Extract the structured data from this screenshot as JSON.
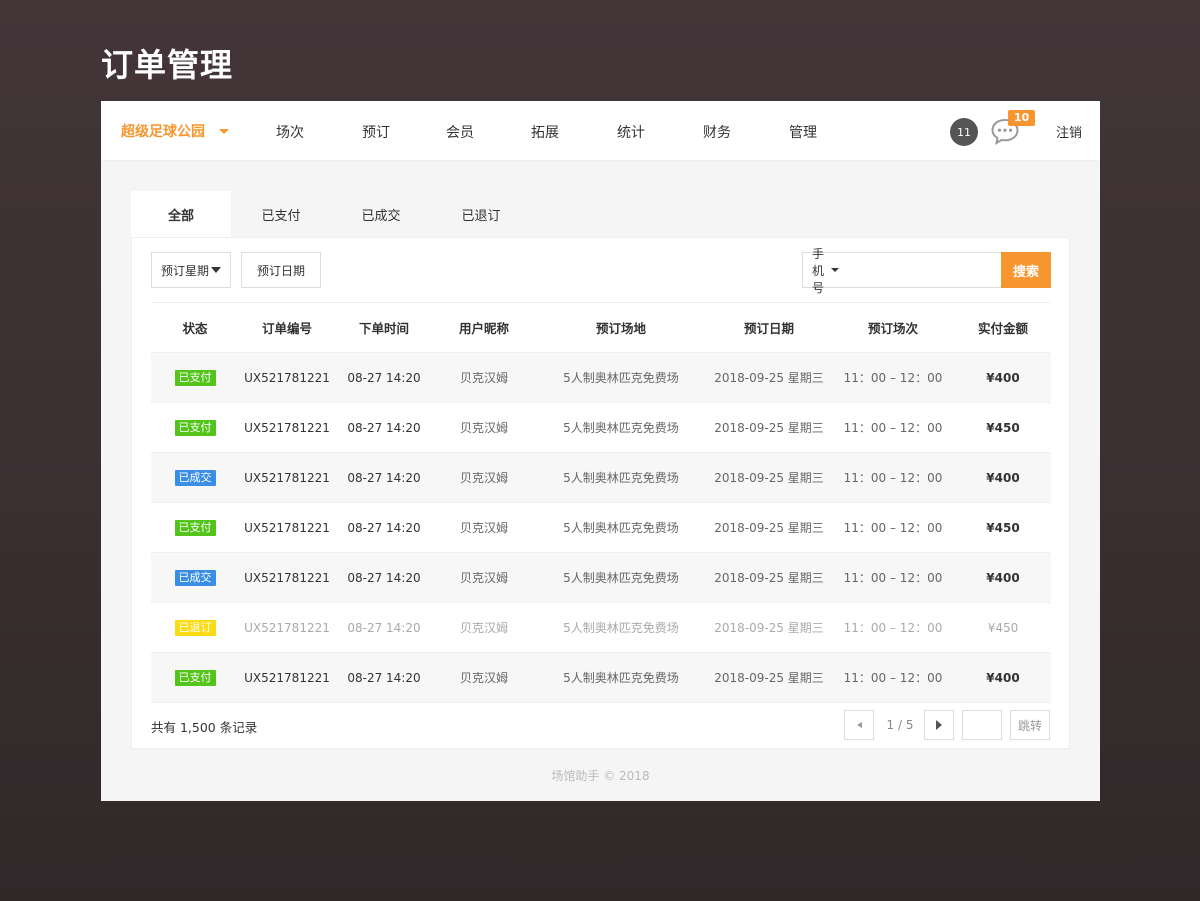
{
  "page_title": "订单管理",
  "nav": {
    "venue": "超级足球公园",
    "items": [
      "场次",
      "预订",
      "会员",
      "拓展",
      "统计",
      "财务",
      "管理"
    ],
    "count_badge": "11",
    "message_badge": "10",
    "logout": "注销"
  },
  "tabs": [
    "全部",
    "已支付",
    "已成交",
    "已退订"
  ],
  "active_tab": "全部",
  "filters": {
    "weekday": "预订星期",
    "date": "预订日期",
    "search_type": "手机号",
    "search_value": "",
    "search_button": "搜索"
  },
  "table": {
    "headers": [
      "状态",
      "订单编号",
      "下单时间",
      "用户昵称",
      "预订场地",
      "预订日期",
      "预订场次",
      "实付金额"
    ],
    "rows": [
      {
        "status": "已支付",
        "order_no": "UX521781221",
        "time": "08-27 14:20",
        "nickname": "贝克汉姆",
        "venue": "5人制奥林匹克免费场",
        "date": "2018-09-25 星期三",
        "slot": "11：00 – 12：00",
        "amount": "¥400"
      },
      {
        "status": "已支付",
        "order_no": "UX521781221",
        "time": "08-27 14:20",
        "nickname": "贝克汉姆",
        "venue": "5人制奥林匹克免费场",
        "date": "2018-09-25 星期三",
        "slot": "11：00 – 12：00",
        "amount": "¥450"
      },
      {
        "status": "已成交",
        "order_no": "UX521781221",
        "time": "08-27 14:20",
        "nickname": "贝克汉姆",
        "venue": "5人制奥林匹克免费场",
        "date": "2018-09-25 星期三",
        "slot": "11：00 – 12：00",
        "amount": "¥400"
      },
      {
        "status": "已支付",
        "order_no": "UX521781221",
        "time": "08-27 14:20",
        "nickname": "贝克汉姆",
        "venue": "5人制奥林匹克免费场",
        "date": "2018-09-25 星期三",
        "slot": "11：00 – 12：00",
        "amount": "¥450"
      },
      {
        "status": "已成交",
        "order_no": "UX521781221",
        "time": "08-27 14:20",
        "nickname": "贝克汉姆",
        "venue": "5人制奥林匹克免费场",
        "date": "2018-09-25 星期三",
        "slot": "11：00 – 12：00",
        "amount": "¥400"
      },
      {
        "status": "已退订",
        "order_no": "UX521781221",
        "time": "08-27 14:20",
        "nickname": "贝克汉姆",
        "venue": "5人制奥林匹克免费场",
        "date": "2018-09-25 星期三",
        "slot": "11：00 – 12：00",
        "amount": "¥450"
      },
      {
        "status": "已支付",
        "order_no": "UX521781221",
        "time": "08-27 14:20",
        "nickname": "贝克汉姆",
        "venue": "5人制奥林匹克免费场",
        "date": "2018-09-25 星期三",
        "slot": "11：00 – 12：00",
        "amount": "¥400"
      }
    ]
  },
  "status_colors": {
    "已支付": "#52c41a",
    "已成交": "#3a8ee6",
    "已退订": "#fadb14"
  },
  "pagination": {
    "total": "共有 1,500 条记录",
    "page_info": "1 / 5",
    "jump_label": "跳转"
  },
  "footer": "场馆助手 © 2018"
}
